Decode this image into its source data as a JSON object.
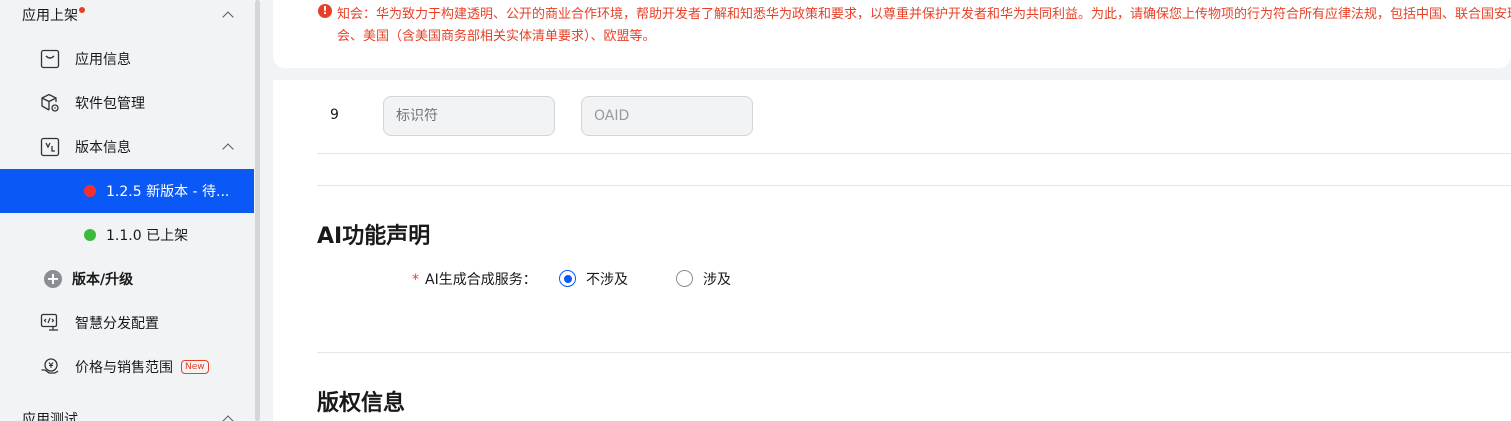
{
  "sidebar": {
    "section_app_release": "应用上架",
    "items": {
      "app_info": "应用信息",
      "package_mgmt": "软件包管理",
      "version_info": "版本信息",
      "version_current": "1.2.5 新版本 - 待...",
      "version_published": "1.1.0 已上架",
      "version_upgrade": "版本/升级",
      "smart_distribution": "智慧分发配置",
      "pricing": "价格与销售范围",
      "new_badge": "New"
    },
    "section_app_test": "应用测试"
  },
  "notice": {
    "text": "知会：华为致力于构建透明、公开的商业合作环境，帮助开发者了解和知悉华为政策和要求，以尊重并保护开发者和华为共同利益。为此，请确保您上传物项的行为符合所有应律法规，包括中国、联合国安理会、美国（含美国商务部相关实体清单要求）、欧盟等。"
  },
  "identifier_row": {
    "index": "9",
    "identifier_placeholder": "标识符",
    "oaid_value": "OAID"
  },
  "ai_section": {
    "title": "AI功能声明",
    "required_mark": "*",
    "field_label": "AI生成合成服务：",
    "options": [
      "不涉及",
      "涉及"
    ],
    "selected": "不涉及"
  },
  "copyright_section": {
    "title": "版权信息"
  },
  "colors": {
    "accent": "#0a59f7",
    "danger": "#e84026",
    "status_pending": "#f23030",
    "status_live": "#3dba3d"
  }
}
